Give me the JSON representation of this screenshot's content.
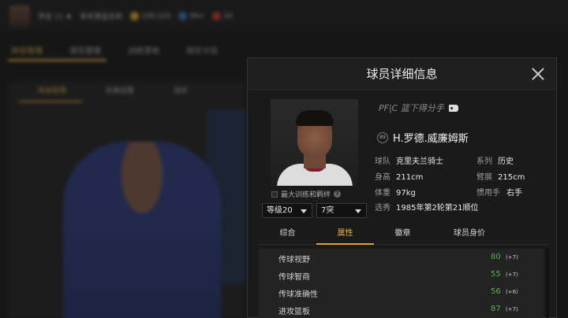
{
  "background": {
    "topbar": {
      "user": "早安 11 ♦",
      "team": "青年男篮名称",
      "coins": "106,225",
      "tickets": "99+",
      "gems": "20"
    },
    "nav": [
      "阵容管理",
      "球员管理",
      "训练营地",
      "球员卡包"
    ],
    "subtabs": [
      "阵容管理",
      "轮换设置",
      "战术"
    ],
    "coin_color": "#d9a33a",
    "ticket_color": "#3a6fb0",
    "gem_color": "#c0392b"
  },
  "dialog": {
    "title": "球员详细信息",
    "position_line": "PF|C 篮下得分手",
    "rating": "89",
    "name": "H.罗德.威廉姆斯",
    "train_label": "最大训练和羁绊",
    "level_select": "等级20",
    "break_select": "7突",
    "info": [
      {
        "key": "球队",
        "value": "克里夫兰骑士"
      },
      {
        "key": "系列",
        "value": "历史"
      },
      {
        "key": "身高",
        "value": "211cm"
      },
      {
        "key": "臂展",
        "value": "215cm"
      },
      {
        "key": "体重",
        "value": "97kg"
      },
      {
        "key": "惯用手",
        "value": "右手"
      },
      {
        "key": "选秀",
        "value": "1985年第2轮第21顺位"
      }
    ],
    "tabs": [
      "综合",
      "属性",
      "徽章",
      "球员身价"
    ],
    "active_tab": "属性",
    "attributes": [
      {
        "label": "传球视野",
        "value": "80",
        "bonus": "(+7)"
      },
      {
        "label": "传球智商",
        "value": "55",
        "bonus": "(+7)"
      },
      {
        "label": "传球准确性",
        "value": "56",
        "bonus": "(+6)"
      },
      {
        "label": "进攻篮板",
        "value": "87",
        "bonus": "(+7)"
      }
    ],
    "accent_color": "#d9a33a",
    "value_color": "#56b256"
  }
}
